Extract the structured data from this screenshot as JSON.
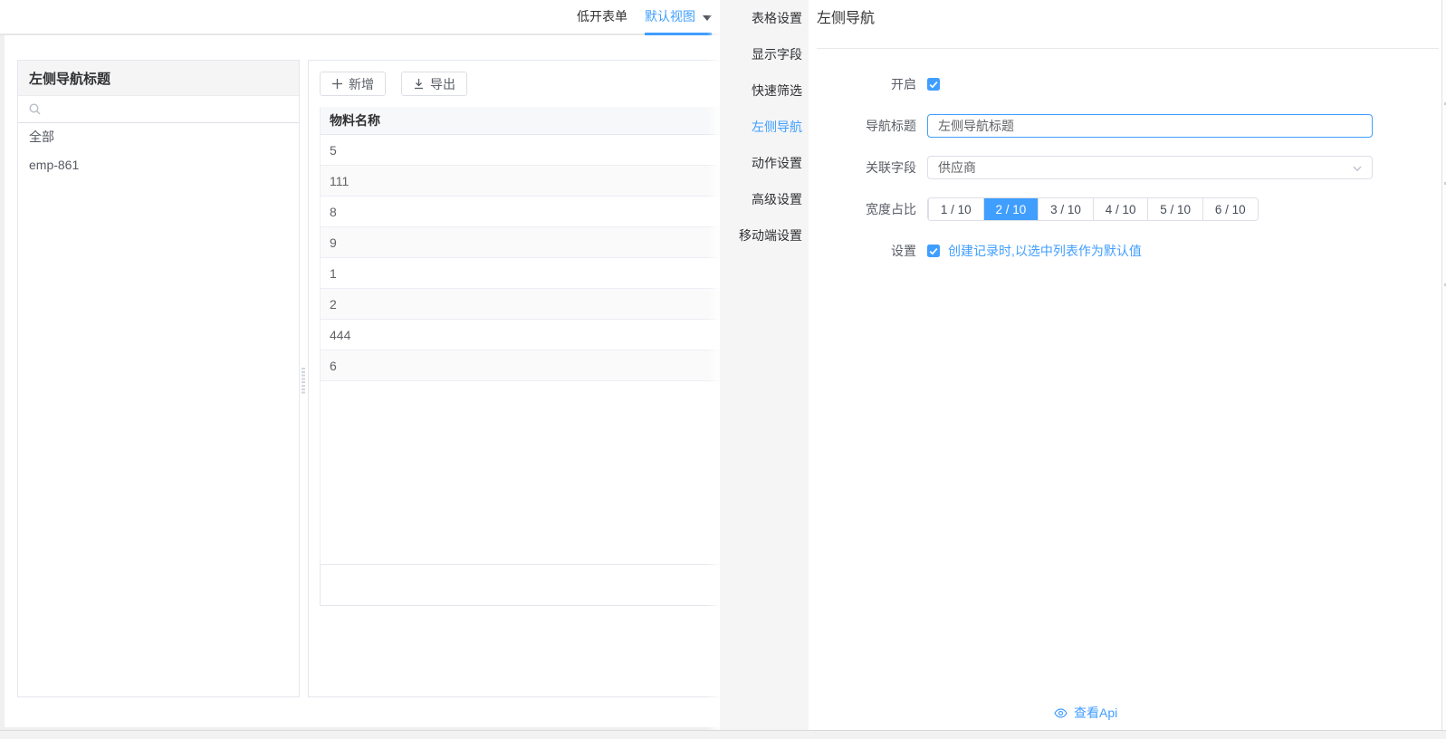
{
  "accent_color": "#409EFF",
  "topbar": {
    "tabs": [
      {
        "label": "低开表单",
        "active": false
      },
      {
        "label": "默认视图",
        "active": true,
        "has_caret": true
      }
    ]
  },
  "left_panel": {
    "title": "左侧导航标题",
    "search_value": "",
    "items": [
      "全部",
      "emp-861"
    ]
  },
  "toolbar": {
    "add_label": "新增",
    "export_label": "导出"
  },
  "table": {
    "columns": [
      "物料名称"
    ],
    "rows": [
      "5",
      "111",
      "8",
      "9",
      "1",
      "2",
      "444",
      "6"
    ]
  },
  "drawer": {
    "menu": [
      {
        "label": "表格设置",
        "active": false
      },
      {
        "label": "显示字段",
        "active": false
      },
      {
        "label": "快速筛选",
        "active": false
      },
      {
        "label": "左侧导航",
        "active": true
      },
      {
        "label": "动作设置",
        "active": false
      },
      {
        "label": "高级设置",
        "active": false
      },
      {
        "label": "移动端设置",
        "active": false
      }
    ],
    "panel_title": "左侧导航",
    "form": {
      "enable_label": "开启",
      "enable_checked": true,
      "nav_title_label": "导航标题",
      "nav_title_value": "左侧导航标题",
      "related_field_label": "关联字段",
      "related_field_value": "供应商",
      "width_ratio_label": "宽度占比",
      "width_options": [
        {
          "label": "1 / 10",
          "active": false
        },
        {
          "label": "2 / 10",
          "active": true
        },
        {
          "label": "3 / 10",
          "active": false
        },
        {
          "label": "4 / 10",
          "active": false
        },
        {
          "label": "5 / 10",
          "active": false
        },
        {
          "label": "6 / 10",
          "active": false
        }
      ],
      "settings_label": "设置",
      "settings_checked": true,
      "settings_note": "创建记录时,以选中列表作为默认值"
    },
    "footer_link": "查看Api"
  }
}
